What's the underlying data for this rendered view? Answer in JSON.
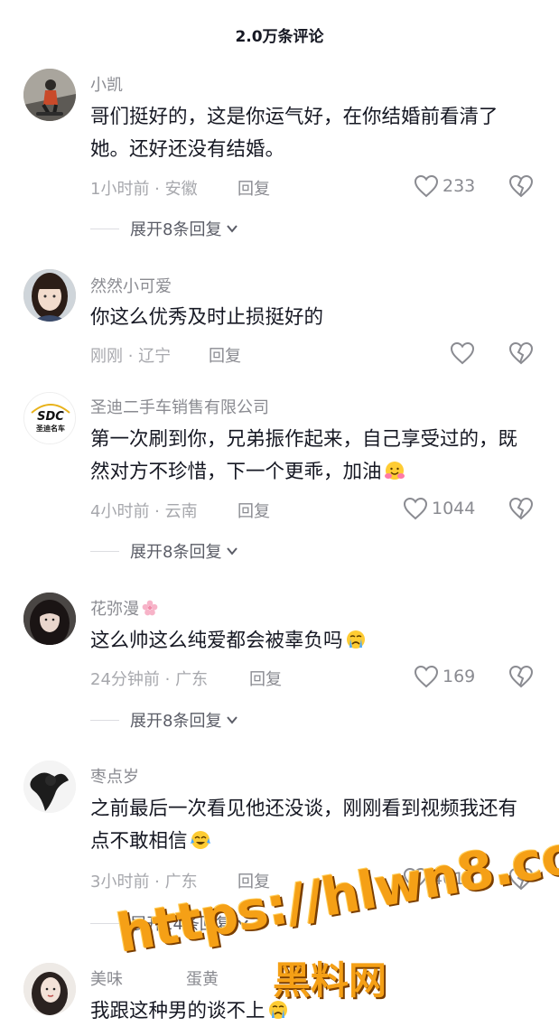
{
  "header": {
    "title": "2.0万条评论"
  },
  "comments": [
    {
      "username": "小凯",
      "text": "哥们挺好的，这是你运气好，在你结婚前看清了她。还好还没有结婚。",
      "meta": "1小时前 · 安徽",
      "reply_label": "回复",
      "likes": "233",
      "expand_label": "展开8条回复",
      "avatar": "skateboarder-avatar"
    },
    {
      "username": "然然小可爱",
      "text": "你这么优秀及时止损挺好的",
      "meta": "刚刚 · 辽宁",
      "reply_label": "回复",
      "likes": "",
      "avatar": "girl-portrait-avatar"
    },
    {
      "username": "圣迪二手车销售有限公司",
      "text": "第一次刷到你，兄弟振作起来，自己享受过的，既然对方不珍惜，下一个更乖，加油",
      "meta": "4小时前 · 云南",
      "reply_label": "回复",
      "likes": "1044",
      "expand_label": "展开8条回复",
      "avatar": "company-logo-avatar",
      "logo_text": "圣迪名车",
      "logo_mark": "SDC"
    },
    {
      "username": "花弥漫",
      "text": "这么帅这么纯爱都会被辜负吗",
      "meta": "24分钟前 · 广东",
      "reply_label": "回复",
      "likes": "169",
      "expand_label": "展开8条回复",
      "avatar": "woman-dark-avatar"
    },
    {
      "username": "枣点岁",
      "text": "之前最后一次看见他还没谈，刚刚看到视频我还有点不敢相信",
      "meta": "3小时前 · 广东",
      "reply_label": "回复",
      "likes": "4016",
      "expand_label": "展开14条回复",
      "avatar": "ink-figure-avatar"
    },
    {
      "username": "美味",
      "username_suffix": "蛋黄",
      "text": "我跟这种男的谈不上",
      "avatar": "woman-portrait-avatar"
    }
  ],
  "watermark": {
    "url": "https://hlwn8.com",
    "cn": "黑料网"
  },
  "colors": {
    "text": "#161823",
    "muted": "#8a8b91",
    "watermark": "#f5a016"
  },
  "icons": {
    "like": "heart-outline-icon",
    "dislike": "broken-heart-icon",
    "expand": "chevron-down-icon"
  }
}
